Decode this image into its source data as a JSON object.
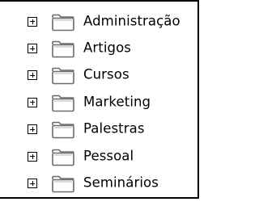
{
  "tree": {
    "items": [
      {
        "label": "Administração",
        "expander": "+",
        "icon": "folder-icon"
      },
      {
        "label": "Artigos",
        "expander": "+",
        "icon": "folder-icon"
      },
      {
        "label": "Cursos",
        "expander": "+",
        "icon": "folder-icon"
      },
      {
        "label": "Marketing",
        "expander": "+",
        "icon": "folder-icon"
      },
      {
        "label": "Palestras",
        "expander": "+",
        "icon": "folder-icon"
      },
      {
        "label": "Pessoal",
        "expander": "+",
        "icon": "folder-icon"
      },
      {
        "label": "Seminários",
        "expander": "+",
        "icon": "folder-icon"
      }
    ]
  },
  "colors": {
    "background": "#ffffff",
    "border": "#000000",
    "text": "#000000",
    "folder_outline": "#6b6b6b",
    "folder_fill": "#ffffff"
  }
}
